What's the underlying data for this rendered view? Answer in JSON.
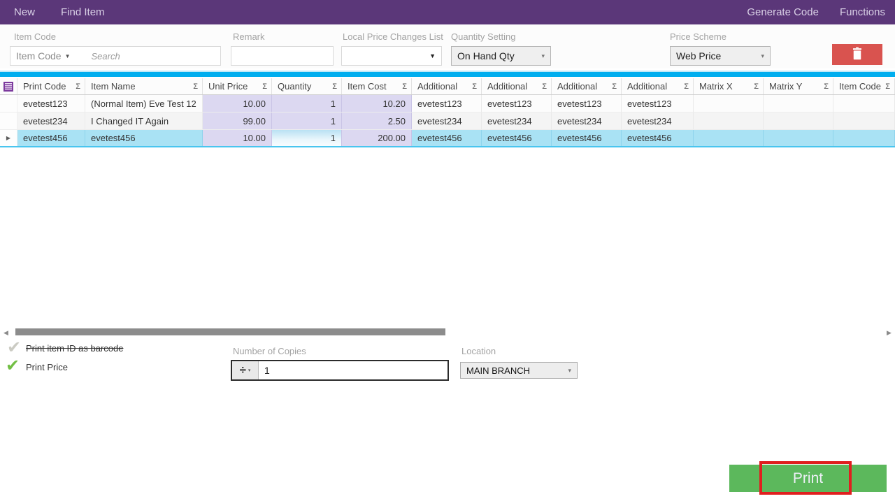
{
  "menu": {
    "left": [
      {
        "label": "New"
      },
      {
        "label": "Find Item"
      }
    ],
    "right": [
      {
        "label": "Generate Code"
      },
      {
        "label": "Functions"
      }
    ]
  },
  "toolbar": {
    "item_code": {
      "label": "Item Code",
      "field_selector": "Item Code",
      "placeholder": "Search",
      "value": ""
    },
    "remark": {
      "label": "Remark",
      "value": ""
    },
    "local_price": {
      "label": "Local Price Changes List",
      "value": ""
    },
    "quantity_setting": {
      "label": "Quantity Setting",
      "value": "On Hand Qty"
    },
    "price_scheme": {
      "label": "Price Scheme",
      "value": "Web Price"
    }
  },
  "grid": {
    "columns": [
      "Print Code",
      "Item Name",
      "Unit Price",
      "Quantity",
      "Item Cost",
      "Additional",
      "Additional",
      "Additional",
      "Additional",
      "Matrix X",
      "Matrix Y",
      "Item Code"
    ],
    "rows": [
      {
        "selected": false,
        "cells": [
          "evetest123",
          "(Normal Item) Eve Test 12",
          "10.00",
          "1",
          "10.20",
          "evetest123",
          "evetest123",
          "evetest123",
          "evetest123",
          "",
          "",
          ""
        ]
      },
      {
        "selected": false,
        "cells": [
          "evetest234",
          "I Changed IT Again",
          "99.00",
          "1",
          "2.50",
          "evetest234",
          "evetest234",
          "evetest234",
          "evetest234",
          "",
          "",
          ""
        ]
      },
      {
        "selected": true,
        "cells": [
          "evetest456",
          "evetest456",
          "10.00",
          "1",
          "200.00",
          "evetest456",
          "evetest456",
          "evetest456",
          "evetest456",
          "",
          "",
          ""
        ]
      }
    ]
  },
  "options": {
    "print_barcode": {
      "label": "Print item ID as barcode",
      "checked": false
    },
    "print_price": {
      "label": "Print Price",
      "checked": true
    },
    "copies": {
      "label": "Number of Copies",
      "value": "1"
    },
    "location": {
      "label": "Location",
      "value": "MAIN BRANCH"
    }
  },
  "footer": {
    "print_label": "Print"
  },
  "icons": {
    "sigma": "Σ",
    "dropdown_solid": "▼",
    "dropdown_small": "▾",
    "chevron_down": "▾",
    "spinner_divide": "÷",
    "scroll_left": "◀",
    "scroll_right": "▶",
    "row_marker": "▶",
    "check": "✔"
  },
  "colors": {
    "header_purple": "#5b3779",
    "accent_cyan": "#00aeef",
    "selection_cyan": "#a9e2f4",
    "tint_lavender": "#dcd8f1",
    "delete_red": "#d9534f",
    "print_green": "#5cb85c",
    "annotation_red": "#e01f1f",
    "check_green": "#72bf44",
    "check_gray": "#cbcbc3"
  }
}
